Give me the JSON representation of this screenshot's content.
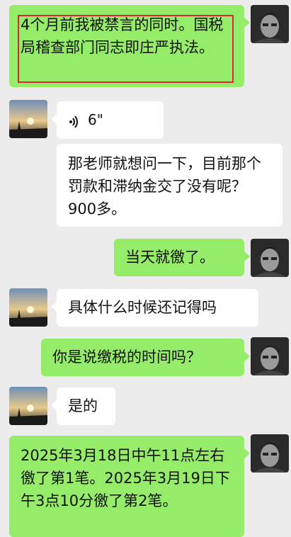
{
  "messages": [
    {
      "side": "right",
      "type": "text",
      "text": "4个月前我被禁言的同时。国税局稽查部门同志即庄严执法。",
      "highlighted": true
    },
    {
      "side": "left",
      "type": "voice",
      "duration": "6\""
    },
    {
      "side": "left",
      "type": "text",
      "text": "那老师就想问一下，目前那个罚款和滞纳金交了没有呢？900多。"
    },
    {
      "side": "right",
      "type": "text",
      "text": "当天就徼了。"
    },
    {
      "side": "left",
      "type": "text",
      "text": "具体什么时候还记得吗"
    },
    {
      "side": "right",
      "type": "text",
      "text": "你是说缴税的时间吗？"
    },
    {
      "side": "left",
      "type": "text",
      "text": "是的"
    },
    {
      "side": "right",
      "type": "text",
      "text": "2025年3月18日中午11点左右徼了第1笔。2025年3月19日下午3点10分徼了第2笔。"
    }
  ],
  "colors": {
    "background": "#ececec",
    "bubble_self": "#95ec69",
    "bubble_other": "#ffffff",
    "highlight": "#e0243a"
  },
  "icons": {
    "voice": "sound-wave-icon"
  }
}
